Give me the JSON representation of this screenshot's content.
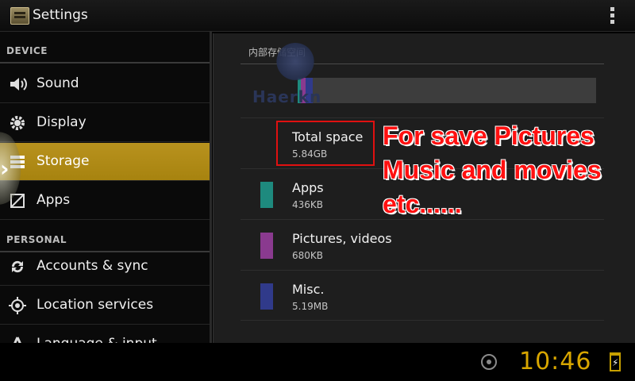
{
  "actionbar": {
    "title": "Settings",
    "app_icon": "settings-app-icon",
    "overflow_icon": "overflow-menu-icon"
  },
  "sections": {
    "device": "DEVICE",
    "personal": "PERSONAL"
  },
  "menu": [
    {
      "label": "Sound",
      "icon": "speaker-icon"
    },
    {
      "label": "Display",
      "icon": "gear-icon"
    },
    {
      "label": "Storage",
      "icon": "storage-icon",
      "selected": true
    },
    {
      "label": "Apps",
      "icon": "apps-icon"
    },
    {
      "label": "Accounts & sync",
      "icon": "sync-icon"
    },
    {
      "label": "Location services",
      "icon": "location-icon"
    },
    {
      "label": "Language & input",
      "icon": "language-icon"
    }
  ],
  "storage": {
    "section_title": "内部存储空间",
    "total": {
      "title": "Total space",
      "size": "5.84GB"
    },
    "items": [
      {
        "title": "Apps",
        "size": "436KB",
        "color": "#1e8a7e"
      },
      {
        "title": "Pictures, videos",
        "size": "680KB",
        "color": "#8a3a8f"
      },
      {
        "title": "Misc.",
        "size": "5.19MB",
        "color": "#303a8a"
      }
    ]
  },
  "watermark": "Haerkn",
  "promo": {
    "line1": "For save Pictures",
    "line2": "Music and movies",
    "line3": "etc......"
  },
  "statusbar": {
    "time": "10:46"
  }
}
